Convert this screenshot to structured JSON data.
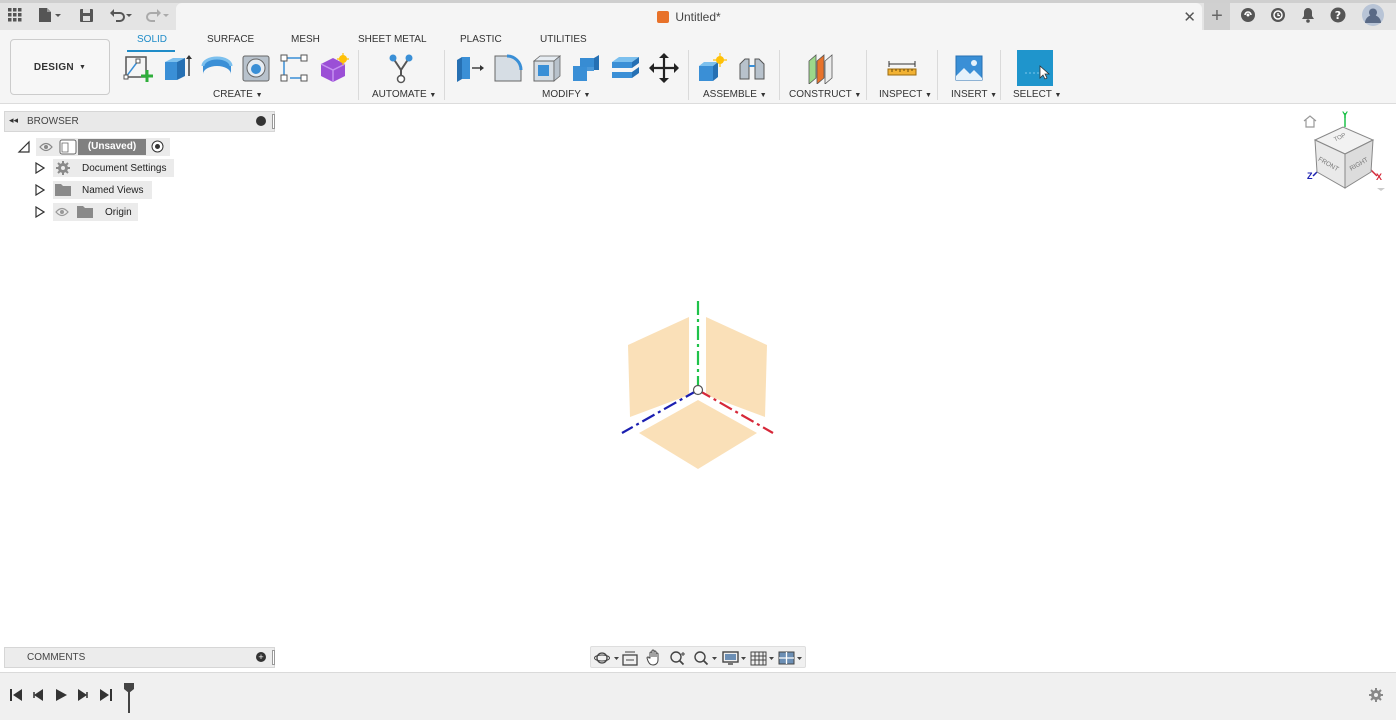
{
  "document": {
    "title": "Untitled*"
  },
  "workspace": {
    "label": "DESIGN"
  },
  "tabs": [
    {
      "label": "SOLID"
    },
    {
      "label": "SURFACE"
    },
    {
      "label": "MESH"
    },
    {
      "label": "SHEET METAL"
    },
    {
      "label": "PLASTIC"
    },
    {
      "label": "UTILITIES"
    }
  ],
  "groups": {
    "create": "CREATE",
    "automate": "AUTOMATE",
    "modify": "MODIFY",
    "assemble": "ASSEMBLE",
    "construct": "CONSTRUCT",
    "inspect": "INSPECT",
    "insert": "INSERT",
    "select": "SELECT"
  },
  "browser": {
    "title": "BROWSER",
    "root": "(Unsaved)",
    "items": [
      {
        "label": "Document Settings",
        "icon": "gear-icon"
      },
      {
        "label": "Named Views",
        "icon": "folder-icon"
      },
      {
        "label": "Origin",
        "icon": "folder-icon"
      }
    ]
  },
  "comments": {
    "title": "COMMENTS"
  },
  "viewcube": {
    "top": "TOP",
    "front": "FRONT",
    "right": "RIGHT",
    "axis_x": "X",
    "axis_y": "Y",
    "axis_z": "Z"
  },
  "colors": {
    "accent": "#1f8cc8",
    "origin_plane": "#f9ddb0",
    "axis_x": "#d62839",
    "axis_y": "#1fc24a",
    "axis_z": "#1b1fb0",
    "select_tile": "#1f95cc"
  }
}
